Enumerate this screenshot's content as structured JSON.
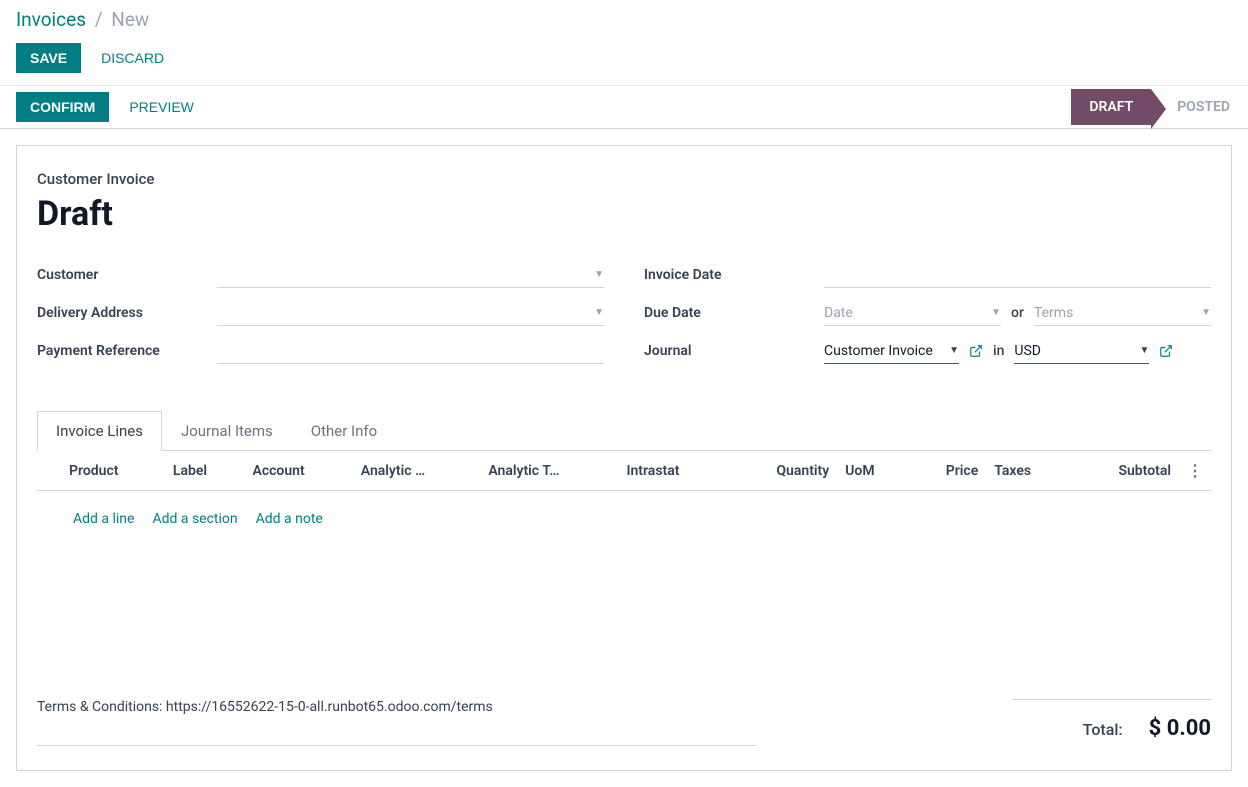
{
  "breadcrumb": {
    "root": "Invoices",
    "sep": "/",
    "current": "New"
  },
  "buttons": {
    "save": "SAVE",
    "discard": "DISCARD",
    "confirm": "CONFIRM",
    "preview": "PREVIEW"
  },
  "status": {
    "draft": "DRAFT",
    "posted": "POSTED"
  },
  "title": {
    "label": "Customer Invoice",
    "value": "Draft"
  },
  "left_fields": {
    "customer": "Customer",
    "delivery_address": "Delivery Address",
    "payment_reference": "Payment Reference"
  },
  "right_fields": {
    "invoice_date": "Invoice Date",
    "due_date": "Due Date",
    "due_date_placeholder": "Date",
    "or": "or",
    "terms_placeholder": "Terms",
    "journal": "Journal",
    "journal_value": "Customer Invoice",
    "in": "in",
    "currency": "USD"
  },
  "tabs": {
    "invoice_lines": "Invoice Lines",
    "journal_items": "Journal Items",
    "other_info": "Other Info"
  },
  "columns": {
    "product": "Product",
    "label": "Label",
    "account": "Account",
    "analytic_account": "Analytic …",
    "analytic_tags": "Analytic T…",
    "intrastat": "Intrastat",
    "quantity": "Quantity",
    "uom": "UoM",
    "price": "Price",
    "taxes": "Taxes",
    "subtotal": "Subtotal"
  },
  "add": {
    "line": "Add a line",
    "section": "Add a section",
    "note": "Add a note"
  },
  "terms_text": "Terms & Conditions: https://16552622-15-0-all.runbot65.odoo.com/terms",
  "totals": {
    "label": "Total:",
    "value": "$ 0.00"
  }
}
